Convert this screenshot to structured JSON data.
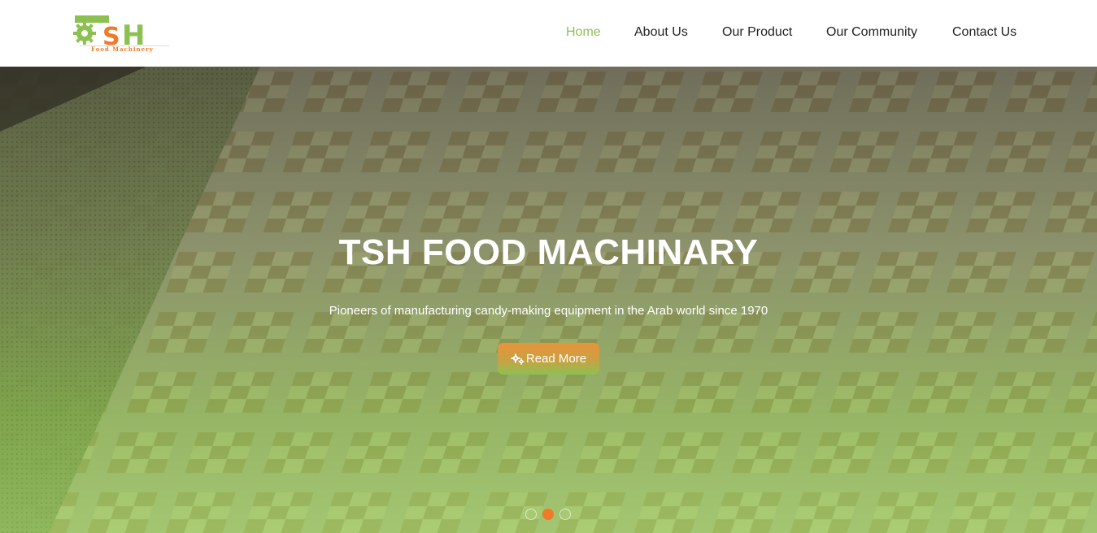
{
  "logo": {
    "text": "TSH",
    "tagline": "Food Machinery",
    "colors": {
      "green": "#8cc152",
      "orange": "#f07a28"
    }
  },
  "nav": {
    "items": [
      {
        "label": "Home",
        "active": true
      },
      {
        "label": "About Us",
        "active": false
      },
      {
        "label": "Our Product",
        "active": false
      },
      {
        "label": "Our Community",
        "active": false
      },
      {
        "label": "Contact Us",
        "active": false
      }
    ],
    "active_color": "#8cc152"
  },
  "hero": {
    "title": "TSH FOOD MACHINARY",
    "subtitle": "Pioneers of manufacturing candy-making equipment in the Arab world since 1970",
    "button": {
      "label": "Read More",
      "icon": "gears-icon"
    },
    "slider": {
      "slide_count": 3,
      "active_index": 1
    }
  }
}
